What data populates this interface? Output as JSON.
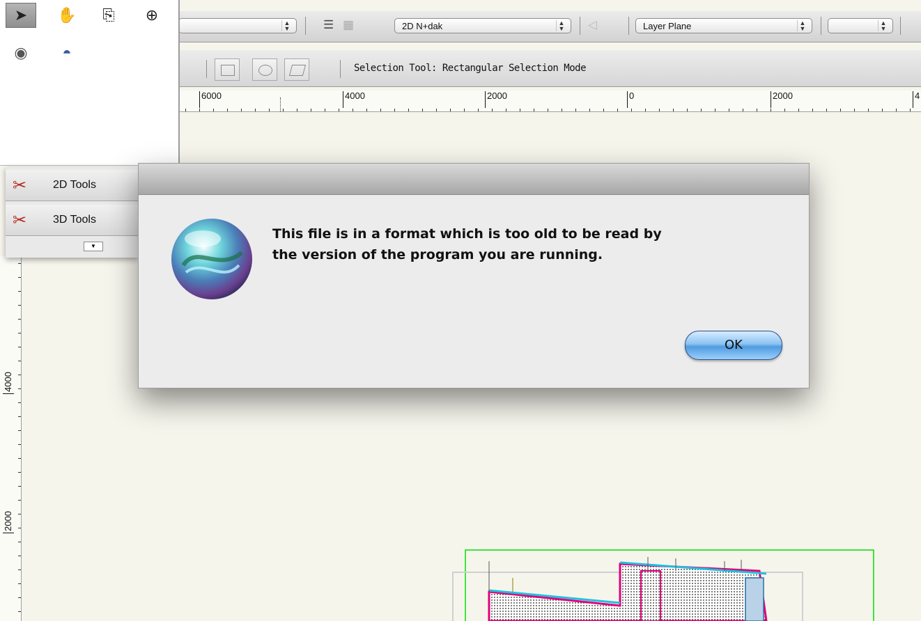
{
  "toolbar": {
    "class_popup_value": "",
    "layer_popup_value": "2D N+dak",
    "plane_popup_value": "Layer Plane",
    "status_text": "Selection Tool: Rectangular Selection Mode"
  },
  "rulers": {
    "horizontal_labels": [
      "6000",
      "4000",
      "2000",
      "0",
      "2000",
      "4"
    ],
    "vertical_labels": [
      "4000",
      "2000"
    ]
  },
  "palette": {
    "tools": [
      "selection-arrow",
      "pan-hand",
      "zoom-page",
      "zoom-magnifier",
      "measure-tape",
      "protractor"
    ]
  },
  "toolsets": {
    "items": [
      {
        "label": "2D Tools",
        "icon": "wrench-screwdriver-icon"
      },
      {
        "label": "3D Tools",
        "icon": "wrench-screwdriver-icon"
      }
    ]
  },
  "dialog": {
    "message_line1": "This file is in a format which is too old to be read by",
    "message_line2": "the version of the program you are running.",
    "ok_label": "OK"
  },
  "colors": {
    "canvas": "#f6f5ec",
    "ok_button": "#6aaeea",
    "drawing_green": "#00e000",
    "drawing_magenta": "#e0007a",
    "drawing_cyan": "#20c0e0"
  }
}
